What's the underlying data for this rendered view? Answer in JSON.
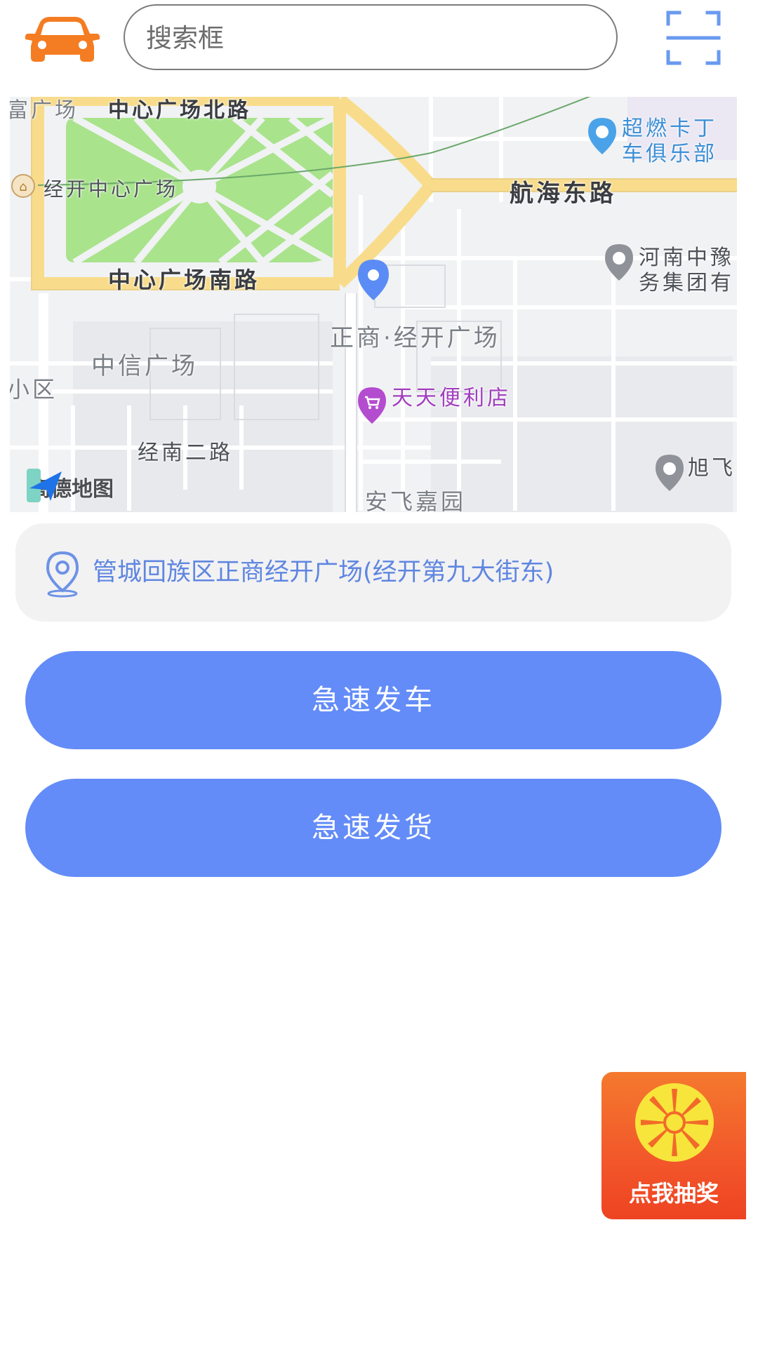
{
  "header": {
    "car_icon": "car-icon",
    "search_placeholder": "搜索框",
    "scan_icon": "scan-icon"
  },
  "map": {
    "labels": {
      "north_road": "中心广场北路",
      "plaza_left": "富广场",
      "center_plaza": "经开中心广场",
      "south_road": "中心广场南路",
      "hanghai_road": "航海东路",
      "club_line1": "超燃卡丁",
      "club_line2": "车俱乐部",
      "group_line1": "河南中豫",
      "group_line2": "务集团有",
      "zhengshang": "正商·经开广场",
      "zhongxin": "中信广场",
      "xiaoqu": "小区",
      "store": "天天便利店",
      "jingnan": "经南二路",
      "xufei": "旭飞",
      "anfei": "安飞嘉园"
    },
    "logo_text": "高德地图",
    "colors": {
      "road_main": "#f8dc8b",
      "green": "#a9e38c",
      "background": "#f1f2f4",
      "pin": "#5b8cf5"
    }
  },
  "address": {
    "icon": "location-pin-icon",
    "text": "管城回族区正商经开广场(经开第九大街东)"
  },
  "buttons": {
    "send_car": "急速发车",
    "send_goods": "急速发货"
  },
  "lottery": {
    "icon": "prize-wheel-icon",
    "label": "点我抽奖"
  }
}
